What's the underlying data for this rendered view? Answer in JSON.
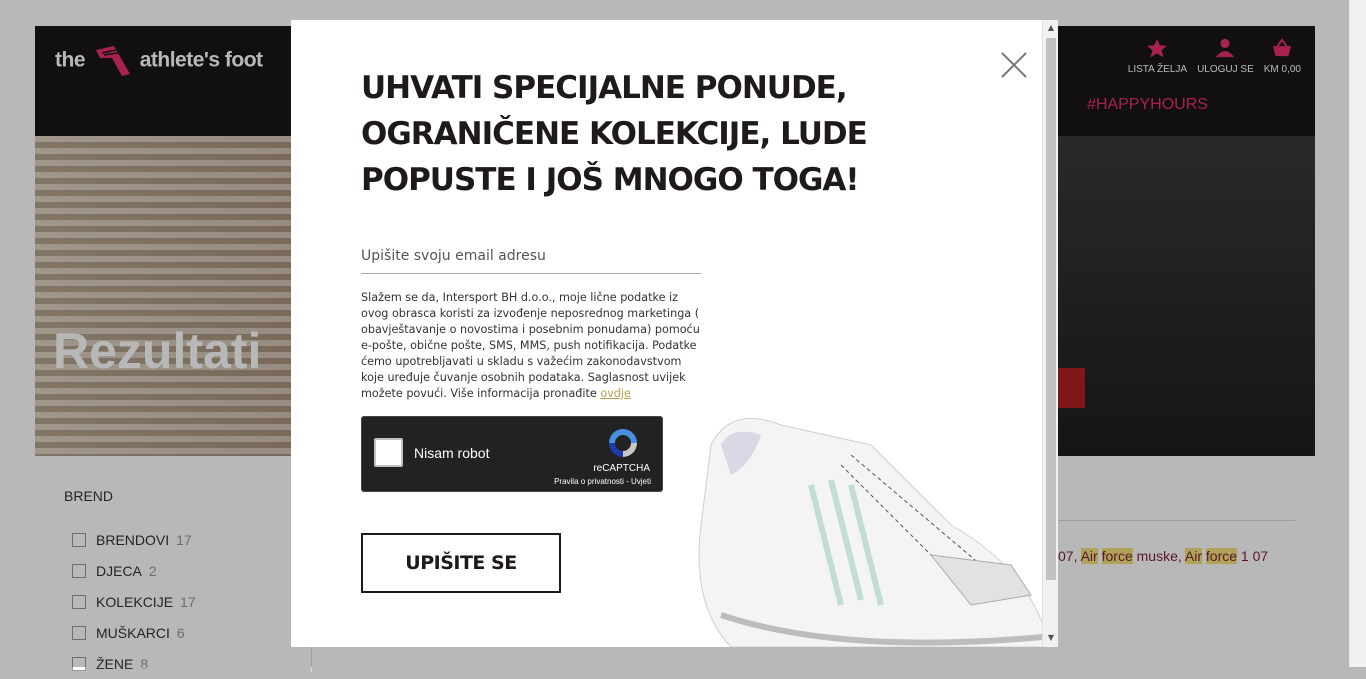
{
  "site": {
    "logo_text_left": "the",
    "logo_text_right": "athlete's foot",
    "header_icons": [
      {
        "icon": "star-icon",
        "label": "LISTA ŽELJA"
      },
      {
        "icon": "user-icon",
        "label": "ULOGUJ SE"
      },
      {
        "icon": "basket-icon",
        "label": "KM 0,00"
      }
    ],
    "nav_visible": "#HAPPYHOURS",
    "hero_title": "Rezultati",
    "filters": {
      "heading": "BREND",
      "items": [
        {
          "label": "BRENDOVI",
          "count": "17"
        },
        {
          "label": "DJECA",
          "count": "2"
        },
        {
          "label": "KOLEKCIJE",
          "count": "17"
        },
        {
          "label": "MUŠKARCI",
          "count": "6"
        },
        {
          "label": "ŽENE",
          "count": "8"
        }
      ]
    },
    "search_terms": {
      "prefix": "07, ",
      "t1": "Air",
      "t2": "force",
      "mid": " muske, ",
      "t3": "Air",
      "t4": "force",
      "suffix": " 1 07"
    }
  },
  "modal": {
    "title": "UHVATI SPECIJALNE PONUDE, OGRANIČENE KOLEKCIJE, LUDE POPUSTE I JOŠ MNOGO TOGA!",
    "email_placeholder": "Upišite svoju email adresu",
    "consent_text": "Slažem se da, Intersport BH d.o.o., moje lične podatke iz ovog obrasca koristi za izvođenje neposrednog marketinga ( obavještavanje o novostima i posebnim ponudama) pomoću e-pošte, obične pošte, SMS, MMS, push notifikacija. Podatke ćemo upotrebljavati u skladu s važećim zakonodavstvom koje uređuje čuvanje osobnih podataka. Saglasnost uvijek možete povući. Više informacija pronađite ",
    "consent_link": "ovdje",
    "recaptcha": {
      "label": "Nisam robot",
      "brand": "reCAPTCHA",
      "links": "Pravila o privatnosti - Uvjeti"
    },
    "submit_label": "UPIŠITE SE"
  },
  "colors": {
    "brand_pink": "#e8316c",
    "header_bg": "#1a1616",
    "link_gold": "#b8a04a"
  }
}
